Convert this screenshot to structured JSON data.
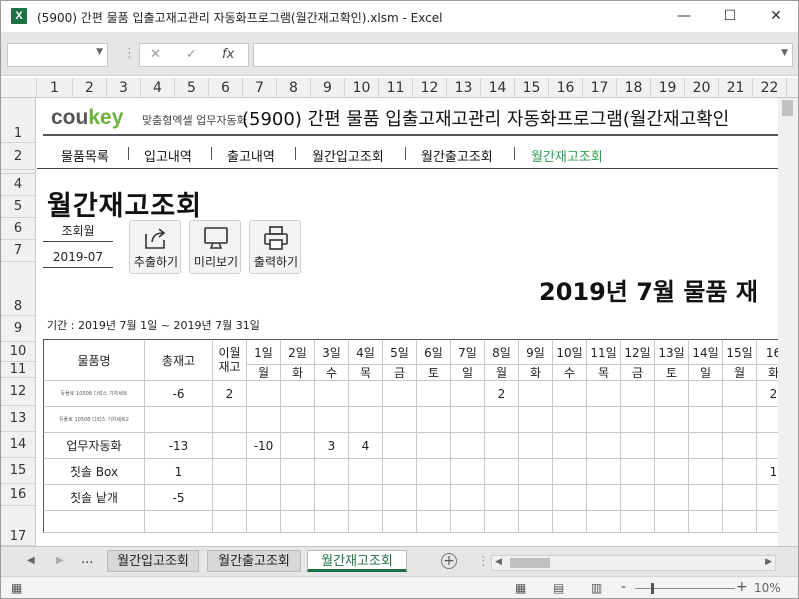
{
  "window": {
    "title": "(5900) 간편 물품 입출고재고관리 자동화프로그램(월간재고확인).xlsm - Excel",
    "app_icon": "X",
    "minimize_label": "—",
    "maximize_label": "☐",
    "close_label": "✕"
  },
  "formula_bar": {
    "name_box": "",
    "cancel_glyph": "✕",
    "enter_glyph": "✓",
    "fx_glyph": "fx",
    "formula": ""
  },
  "column_headers": [
    "1",
    "2",
    "3",
    "4",
    "5",
    "6",
    "7",
    "8",
    "9",
    "10",
    "11",
    "12",
    "13",
    "14",
    "15",
    "16",
    "17",
    "18",
    "19",
    "20",
    "21",
    "22",
    "2"
  ],
  "row_headers": [
    "1",
    "2",
    "3",
    "4",
    "5",
    "6",
    "7",
    "8",
    "9",
    "10",
    "11",
    "12",
    "13",
    "14",
    "15",
    "16",
    "17"
  ],
  "banner": {
    "logo_left": "cou",
    "logo_right": "key",
    "logo_sub": "맞춤형엑셀 업무자동화",
    "title": "(5900) 간편 물품 입출고재고관리 자동화프로그램(월간재고확인"
  },
  "nav": {
    "items": [
      "물품목록",
      "입고내역",
      "출고내역",
      "월간입고조회",
      "월간출고조회",
      "월간재고조회"
    ],
    "separators": [
      "|",
      "|",
      "|",
      "|",
      "|"
    ]
  },
  "page": {
    "title": "월간재고조회",
    "query_label": "조회월",
    "query_value": "2019-07",
    "buttons": {
      "export": "추출하기",
      "preview": "미리보기",
      "print": "출력하기"
    },
    "report_title": "2019년 7월 물품 재",
    "period": "기간 : 2019년 7월 1일 ~ 2019년 7월 31일"
  },
  "table": {
    "headers": {
      "item": "물품명",
      "total": "총재고",
      "carry_line1": "이월",
      "carry_line2": "재고"
    },
    "days": [
      "1일",
      "2일",
      "3일",
      "4일",
      "5일",
      "6일",
      "7일",
      "8일",
      "9일",
      "10일",
      "11일",
      "12일",
      "13일",
      "14일",
      "15일",
      "16"
    ],
    "weekdays": [
      "월",
      "화",
      "수",
      "목",
      "금",
      "토",
      "일",
      "월",
      "화",
      "수",
      "목",
      "금",
      "토",
      "일",
      "월",
      "화"
    ],
    "rows": [
      {
        "name": "듀플로 10508 디럭스 기차세트",
        "total": "-6",
        "carry": "2",
        "cells": [
          "",
          "",
          "",
          "",
          "",
          "",
          "",
          "2",
          "",
          "",
          "",
          "",
          "",
          "",
          "",
          "2"
        ],
        "small": true
      },
      {
        "name": "듀플로 10508 디럭스 기차세트2",
        "total": "",
        "carry": "",
        "cells": [
          "",
          "",
          "",
          "",
          "",
          "",
          "",
          "",
          "",
          "",
          "",
          "",
          "",
          "",
          "",
          ""
        ],
        "small": true
      },
      {
        "name": "업무자동화",
        "total": "-13",
        "carry": "",
        "cells": [
          "-10",
          "",
          "3",
          "4",
          "",
          "",
          "",
          "",
          "",
          "",
          "",
          "",
          "",
          "",
          "",
          ""
        ],
        "small": false
      },
      {
        "name": "칫솔 Box",
        "total": "1",
        "carry": "",
        "cells": [
          "",
          "",
          "",
          "",
          "",
          "",
          "",
          "",
          "",
          "",
          "",
          "",
          "",
          "",
          "",
          "1"
        ],
        "small": false
      },
      {
        "name": "칫솔 낱개",
        "total": "-5",
        "carry": "",
        "cells": [
          "",
          "",
          "",
          "",
          "",
          "",
          "",
          "",
          "",
          "",
          "",
          "",
          "",
          "",
          "",
          ""
        ],
        "small": false
      },
      {
        "name": "",
        "total": "",
        "carry": "",
        "cells": [
          "",
          "",
          "",
          "",
          "",
          "",
          "",
          "",
          "",
          "",
          "",
          "",
          "",
          "",
          "",
          ""
        ],
        "small": false
      }
    ]
  },
  "sheet_tabs": {
    "more": "...",
    "tabs": [
      "월간입고조회",
      "월간출고조회",
      "월간재고조회"
    ],
    "active_index": 2,
    "add_glyph": "+"
  },
  "status_bar": {
    "zoom_minus": "-",
    "zoom_plus": "+",
    "zoom": "10%"
  },
  "colors": {
    "excel_green": "#1e7145",
    "active_nav": "#2e9a53",
    "logo_key": "#6bb33a"
  }
}
